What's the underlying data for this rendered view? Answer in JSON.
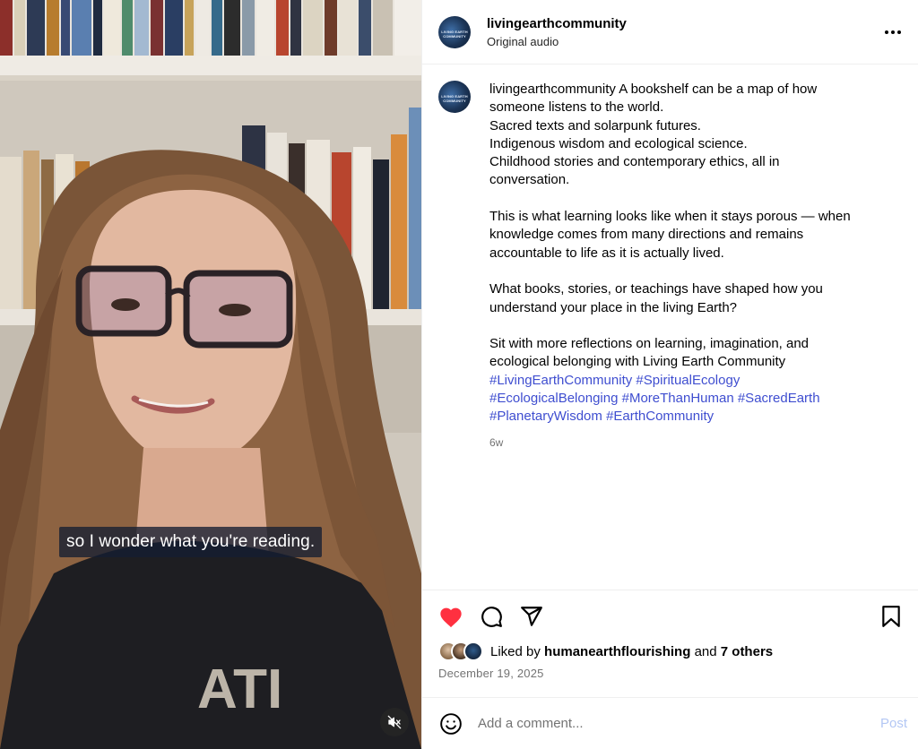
{
  "video": {
    "caption_text": "so I wonder what you're reading."
  },
  "header": {
    "username": "livingearthcommunity",
    "audio_label": "Original audio",
    "avatar_text": "LIVING EARTH COMMUNITY"
  },
  "post": {
    "username": "livingearthcommunity",
    "caption_lines": [
      "A bookshelf can be a map of how",
      "someone listens to the world.",
      "Sacred texts and solarpunk futures.",
      "Indigenous wisdom and ecological science.",
      "Childhood stories and contemporary ethics, all in",
      "conversation.",
      "",
      "This is what learning looks like when it stays porous — when",
      "knowledge comes from many directions and remains",
      "accountable to life as it is actually lived.",
      "",
      "What books, stories, or teachings have shaped how you",
      "understand your place in the living Earth?",
      "",
      "Sit with more reflections on learning, imagination, and",
      "ecological belonging with Living Earth Community"
    ],
    "hashtags": [
      "#LivingEarthCommunity",
      "#SpiritualEcology",
      "#EcologicalBelonging",
      "#MoreThanHuman",
      "#SacredEarth",
      "#PlanetaryWisdom",
      "#EarthCommunity"
    ],
    "age": "6w"
  },
  "actions": {
    "liked_by_prefix": "Liked by",
    "liked_by_user": "humanearthflourishing",
    "liked_by_and": "and",
    "liked_by_others": "7 others",
    "date": "December 19, 2025",
    "like_color": "#ff3040",
    "icons": [
      "heart-icon",
      "comment-icon",
      "share-icon",
      "bookmark-icon"
    ]
  },
  "comment_box": {
    "placeholder": "Add a comment...",
    "post_label": "Post"
  }
}
